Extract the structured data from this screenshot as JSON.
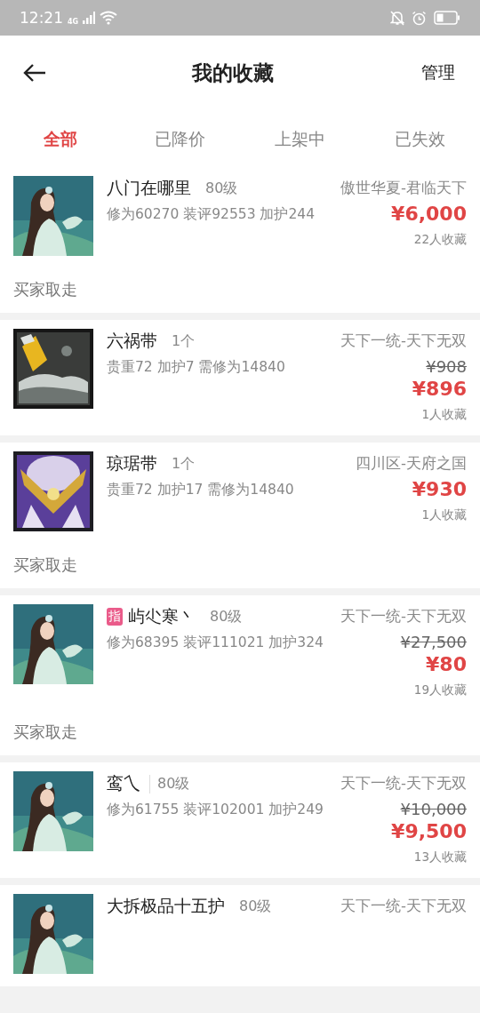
{
  "status_bar": {
    "time": "12:21",
    "network": "4G"
  },
  "header": {
    "title": "我的收藏",
    "action": "管理"
  },
  "tabs": [
    {
      "label": "全部",
      "selected": true
    },
    {
      "label": "已降价",
      "selected": false
    },
    {
      "label": "上架中",
      "selected": false
    },
    {
      "label": "已失效",
      "selected": false
    }
  ],
  "items": [
    {
      "kind": "figure",
      "name": "八门在哪里",
      "level": "80级",
      "divided": false,
      "detail": "修为60270 装评92553 加护244",
      "server": "傲世华夏-君临天下",
      "price": "¥6,000",
      "favorites": "22人收藏",
      "note": "买家取走"
    },
    {
      "kind": "stone",
      "name": "六祸带",
      "level": "1个",
      "divided": false,
      "detail": "贵重72 加护7 需修为14840",
      "server": "天下一统-天下无双",
      "original_price": "¥908",
      "price": "¥896",
      "favorites": "1人收藏"
    },
    {
      "kind": "gold",
      "name": "琼琚带",
      "level": "1个",
      "divided": false,
      "detail": "贵重72 加护17 需修为14840",
      "server": "四川区-天府之国",
      "price": "¥930",
      "favorites": "1人收藏",
      "note": "买家取走"
    },
    {
      "kind": "figure",
      "badge": "指",
      "name": "屿尐寒丶",
      "level": "80级",
      "divided": false,
      "detail": "修为68395 装评111021 加护324",
      "server": "天下一统-天下无双",
      "original_price": "¥27,500",
      "price": "¥80",
      "favorites": "19人收藏",
      "note": "买家取走"
    },
    {
      "kind": "figure",
      "name": "鸾乀",
      "level": "80级",
      "divided": true,
      "detail": "修为61755 装评102001 加护249",
      "server": "天下一统-天下无双",
      "original_price": "¥10,000",
      "price": "¥9,500",
      "favorites": "13人收藏"
    },
    {
      "kind": "figure",
      "name": "大拆极品十五护",
      "level": "80级",
      "divided": false,
      "server": "天下一统-天下无双"
    }
  ]
}
